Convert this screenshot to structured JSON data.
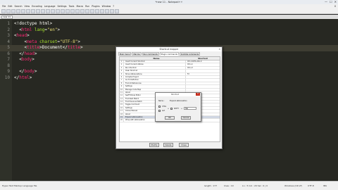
{
  "window": {
    "title": "*new 11 - Notepad++",
    "controls": [
      "—",
      "☐",
      "✕"
    ]
  },
  "menu": [
    "File",
    "Edit",
    "Search",
    "View",
    "Encoding",
    "Language",
    "Settings",
    "Tools",
    "Macro",
    "Run",
    "Plugins",
    "Window",
    "?"
  ],
  "menu_close": "X",
  "tab": {
    "label": "new 11"
  },
  "editor": {
    "line_numbers": [
      "1",
      "2",
      "3",
      "4",
      "5",
      "6",
      "7",
      "8",
      "9",
      "10"
    ],
    "lines": [
      [
        {
          "t": "<!doctype html>",
          "c": "op"
        }
      ],
      [
        {
          "t": "  <",
          "c": "op"
        },
        {
          "t": "html",
          "c": "tag"
        },
        {
          "t": " lang",
          "c": "attr"
        },
        {
          "t": "=",
          "c": "op"
        },
        {
          "t": "\"en\"",
          "c": "str"
        },
        {
          "t": ">",
          "c": "op"
        }
      ],
      [
        {
          "t": "<",
          "c": "op"
        },
        {
          "t": "head",
          "c": "tag"
        },
        {
          "t": ">",
          "c": "op"
        }
      ],
      [
        {
          "t": "    <",
          "c": "op"
        },
        {
          "t": "meta",
          "c": "tag"
        },
        {
          "t": " charset",
          "c": "attr"
        },
        {
          "t": "=",
          "c": "op"
        },
        {
          "t": "\"UTF-8\"",
          "c": "str"
        },
        {
          "t": ">",
          "c": "op"
        }
      ],
      [
        {
          "t": "    <",
          "c": "op"
        },
        {
          "t": "title",
          "c": "tag"
        },
        {
          "t": ">",
          "c": "op"
        },
        {
          "t": "Document",
          "c": "txt"
        },
        {
          "t": "</",
          "c": "op"
        },
        {
          "t": "title",
          "c": "tag"
        },
        {
          "t": ">",
          "c": "op"
        }
      ],
      [
        {
          "t": "  </",
          "c": "op"
        },
        {
          "t": "head",
          "c": "tag"
        },
        {
          "t": ">",
          "c": "op"
        }
      ],
      [
        {
          "t": "  <",
          "c": "op"
        },
        {
          "t": "body",
          "c": "tag"
        },
        {
          "t": ">",
          "c": "op"
        }
      ],
      [
        {
          "t": "",
          "c": "op"
        }
      ],
      [
        {
          "t": "  </",
          "c": "op"
        },
        {
          "t": "body",
          "c": "tag"
        },
        {
          "t": ">",
          "c": "op"
        }
      ],
      [
        {
          "t": "</",
          "c": "op"
        },
        {
          "t": "html",
          "c": "tag"
        },
        {
          "t": ">",
          "c": "op"
        }
      ]
    ],
    "current_line": 5
  },
  "dialog": {
    "title": "Shortcut mapper",
    "close": "✕",
    "tabs": [
      "Main menu",
      "Macros",
      "Run commands",
      "Plugin commands",
      "Scintilla commands"
    ],
    "active_tab": 3,
    "columns": {
      "name": "Name",
      "shortcut": "Shortcut"
    },
    "rows": [
      {
        "idx": "1",
        "name": "Insert Current Shortcut",
        "shortcut": "Ctrl+Shift+Alt+X"
      },
      {
        "idx": "2",
        "name": "Insert Current Abbrev",
        "shortcut": "Ctrl+1"
      },
      {
        "idx": "3",
        "name": "Run Shortcut",
        "shortcut": "Ctrl+3"
      },
      {
        "idx": "4",
        "name": "Clear Shortcut",
        "shortcut": ""
      },
      {
        "idx": "5",
        "name": "Show Abbreviations",
        "shortcut": "F2"
      },
      {
        "idx": "6",
        "name": "Compile Project",
        "shortcut": ""
      },
      {
        "idx": "7",
        "name": "Go To Definition",
        "shortcut": ""
      },
      {
        "idx": "8",
        "name": "Find All References",
        "shortcut": ""
      },
      {
        "idx": "9",
        "name": "Settings",
        "shortcut": ""
      },
      {
        "idx": "10",
        "name": "Manage Code Map",
        "shortcut": ""
      },
      {
        "idx": "11",
        "name": "About",
        "shortcut": ""
      },
      {
        "idx": "12",
        "name": "Swiff Whole Editor",
        "shortcut": ""
      },
      {
        "idx": "13",
        "name": "Find Next Match",
        "shortcut": ""
      },
      {
        "idx": "14",
        "name": "Find Previous Match",
        "shortcut": ""
      },
      {
        "idx": "15",
        "name": "Toggle Comment",
        "shortcut": ""
      },
      {
        "idx": "16",
        "name": "Settings",
        "shortcut": ""
      },
      {
        "idx": "17",
        "name": "Online Manual",
        "shortcut": ""
      },
      {
        "idx": "18",
        "name": "About",
        "shortcut": ""
      },
      {
        "idx": "19",
        "name": "Expand abbreviation",
        "shortcut": "Tab"
      },
      {
        "idx": "20",
        "name": "Wrap with abbreviation",
        "shortcut": "Ctrl+Shift+Enter"
      }
    ],
    "selected_row": 18,
    "buttons": {
      "modify": "Modify",
      "delete": "Delete",
      "close": "Close"
    }
  },
  "subdialog": {
    "title": "Shortcut",
    "close": "X",
    "name_label": "Name :",
    "name_value": "Expand abbreviation",
    "ctrl_label": "CTRL",
    "alt_label": "ALT",
    "shift_label": "SHIFT",
    "plus": "+",
    "key_value": "Tab",
    "ok": "OK",
    "cancel": "Cancel"
  },
  "status": {
    "file_type": "Hyper Text Markup Language file",
    "length": "length : 177",
    "lines": "lines : 10",
    "position": "Ln : 5   Col : 20   Sel : 0 | 0",
    "eol": "Windows (CR LF)",
    "encoding": "UTF-8",
    "mode": "INS"
  },
  "colors": {
    "editor_bg": "#272822",
    "tag": "#f92672",
    "attr": "#a6e22e",
    "string": "#e6db74",
    "dialog_bg": "#f0f0f0"
  }
}
